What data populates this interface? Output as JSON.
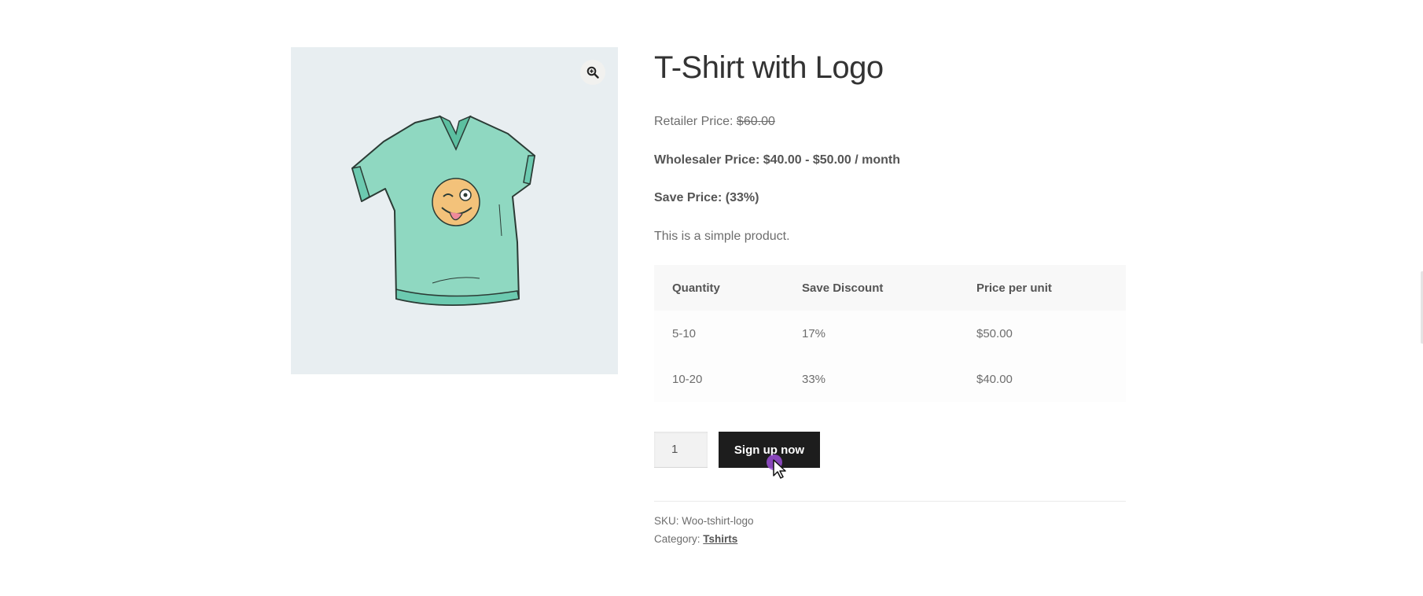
{
  "product": {
    "title": "T-Shirt with Logo",
    "retailer_label": "Retailer Price: ",
    "retailer_price": "$60.00",
    "wholesaler_text": "Wholesaler Price: $40.00 - $50.00 / month",
    "save_label": "Save Price: ",
    "save_value": "(33%)",
    "description": "This is a simple product."
  },
  "tiers": {
    "headers": [
      "Quantity",
      "Save Discount",
      "Price per unit"
    ],
    "rows": [
      [
        "5-10",
        "17%",
        "$50.00"
      ],
      [
        "10-20",
        "33%",
        "$40.00"
      ]
    ]
  },
  "cart": {
    "quantity": "1",
    "button_label": "Sign up now"
  },
  "meta": {
    "sku_label": "SKU: ",
    "sku_value": "Woo-tshirt-logo",
    "category_label": "Category: ",
    "category_value": "Tshirts"
  },
  "icons": {
    "zoom": "zoom-in-icon",
    "cursor": "mouse-pointer-icon"
  },
  "colors": {
    "button_bg": "#1d1d1d",
    "gallery_bg": "#e8eef1",
    "shirt": "#8fd8c1",
    "cursor_dot": "#9b4fd6"
  }
}
